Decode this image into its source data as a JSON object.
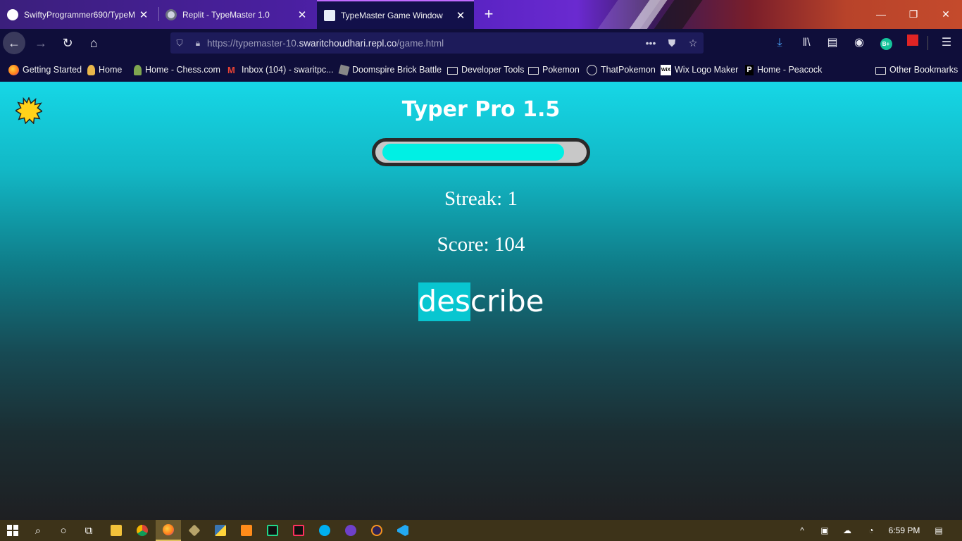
{
  "browser": {
    "tabs": [
      {
        "title": "SwiftyProgrammer690/TypeM",
        "icon": "github-icon",
        "active": false
      },
      {
        "title": "Replit - TypeMaster 1.0",
        "icon": "replit-icon",
        "active": false
      },
      {
        "title": "TypeMaster Game Window",
        "icon": "page-icon",
        "active": true
      }
    ],
    "new_tab_label": "+",
    "url": {
      "prefix": "https://typemaster-10.",
      "host": "swaritchoudhari.repl.co",
      "path": "/game.html"
    },
    "url_more_label": "•••",
    "bookmarks": [
      {
        "label": "Getting Started",
        "icon": "firefox-icon"
      },
      {
        "label": "Home",
        "icon": "user-icon"
      },
      {
        "label": "Home - Chess.com",
        "icon": "chess-pawn-icon"
      },
      {
        "label": "Inbox (104) - swaritpc...",
        "icon": "gmail-icon"
      },
      {
        "label": "Doomspire Brick Battle",
        "icon": "roblox-icon"
      },
      {
        "label": "Developer Tools",
        "icon": "folder-icon"
      },
      {
        "label": "Pokemon",
        "icon": "folder-icon"
      },
      {
        "label": "ThatPokemon",
        "icon": "globe-icon"
      },
      {
        "label": "Wix Logo Maker",
        "icon": "wix-icon"
      },
      {
        "label": "Home - Peacock",
        "icon": "peacock-icon"
      }
    ],
    "other_bookmarks": "Other Bookmarks",
    "account_badge": "B+"
  },
  "game": {
    "title": "Typer Pro 1.5",
    "progress": 0.92,
    "streak_text": "Streak: 1",
    "score_text": "Score: 104",
    "word_typed": "des",
    "word_remaining": "cribe",
    "colors": {
      "progress_fill": "#00f0e4",
      "typed_highlight": "#08c6d0",
      "top_gradient": "#16d7e6",
      "bottom_gradient": "#1e1f22"
    }
  },
  "taskbar": {
    "clock": "6:59 PM",
    "tray_chevron": "^"
  }
}
